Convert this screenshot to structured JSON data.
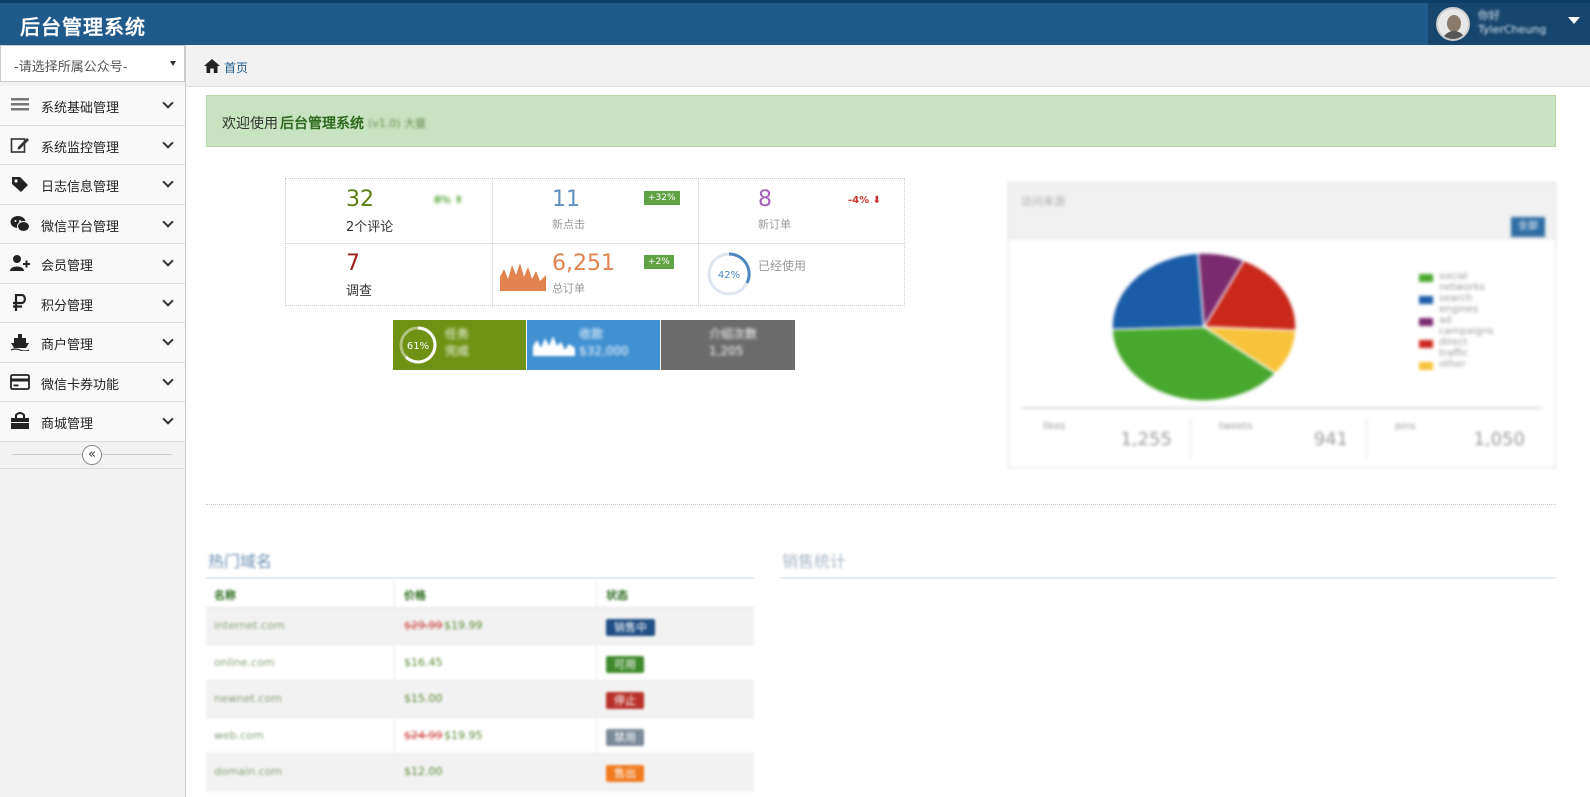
{
  "app": {
    "title": "后台管理系统"
  },
  "user": {
    "line1": "你好",
    "line2": "TylerCheung"
  },
  "account_select": {
    "value": "-请选择所属公众号-"
  },
  "sidebar": {
    "items": [
      {
        "label": "系统基础管理",
        "icon": "list-icon"
      },
      {
        "label": "系统监控管理",
        "icon": "edit-icon"
      },
      {
        "label": "日志信息管理",
        "icon": "tag-icon"
      },
      {
        "label": "微信平台管理",
        "icon": "wechat-icon"
      },
      {
        "label": "会员管理",
        "icon": "add-user-icon"
      },
      {
        "label": "积分管理",
        "icon": "ruble-icon"
      },
      {
        "label": "商户管理",
        "icon": "ship-icon"
      },
      {
        "label": "微信卡券功能",
        "icon": "credit-card-icon"
      },
      {
        "label": "商城管理",
        "icon": "shopping-bag-icon"
      }
    ],
    "collapse_label": "«"
  },
  "breadcrumb": {
    "home": "首页"
  },
  "welcome": {
    "prefix": "欢迎使用",
    "name": "后台管理系统",
    "version": "(v1.0) 大量"
  },
  "stats": [
    {
      "value": "32",
      "label": "2个评论",
      "trend": "8%",
      "color": "#6a8a1f"
    },
    {
      "value": "11",
      "label": "新点击",
      "trend": "+32%",
      "color": "#5f8fc0"
    },
    {
      "value": "8",
      "label": "新订单",
      "trend": "-4%",
      "color": "#a55fb8"
    },
    {
      "value": "7",
      "label": "调查",
      "trend": "",
      "color": "#a33"
    },
    {
      "value": "6,251",
      "label": "总订单",
      "trend": "+2%",
      "color": "#e2824f"
    },
    {
      "value": "",
      "label": "已经使用",
      "trend": "",
      "color": "#5f8fc0",
      "percent": "42%"
    }
  ],
  "tiles": [
    {
      "title": "任务",
      "sub": "完成",
      "percent": "61%",
      "color": "#6f9214"
    },
    {
      "title": "收款",
      "sub": "$32,000",
      "color": "#4090d2"
    },
    {
      "title": "介绍次数",
      "sub": "1,205",
      "color": "#6b6b6b"
    }
  ],
  "traffic": {
    "title": "访问来源",
    "button": "全部",
    "chart_data": {
      "type": "pie",
      "series": [
        {
          "name": "social networks",
          "value": 38.7,
          "color": "#48a82d"
        },
        {
          "name": "search engines",
          "value": 24.5,
          "color": "#1a5ca8"
        },
        {
          "name": "ad campaigns",
          "value": 8.2,
          "color": "#7a2a6e"
        },
        {
          "name": "direct traffic",
          "value": 18.6,
          "color": "#c9281a"
        },
        {
          "name": "other",
          "value": 10.0,
          "color": "#f7c33a"
        }
      ]
    },
    "footer": [
      {
        "label": "likes",
        "value": "1,255"
      },
      {
        "label": "tweets",
        "value": "941"
      },
      {
        "label": "pins",
        "value": "1,050"
      }
    ]
  },
  "hot_domains": {
    "title": "热门域名",
    "columns": [
      "名称",
      "价格",
      "状态"
    ],
    "rows": [
      {
        "name": "internet.com",
        "price_old": "$29.99",
        "price": "$19.99",
        "status": "销售中",
        "status_color": "#1f4f85"
      },
      {
        "name": "online.com",
        "price_old": "",
        "price": "$16.45",
        "status": "可用",
        "status_color": "#3f8a2d"
      },
      {
        "name": "newnet.com",
        "price_old": "",
        "price": "$15.00",
        "status": "停止",
        "status_color": "#b8322a"
      },
      {
        "name": "web.com",
        "price_old": "$24.99",
        "price": "$19.95",
        "status": "禁用",
        "status_color": "#7b8a98"
      },
      {
        "name": "domain.com",
        "price_old": "",
        "price": "$12.00",
        "status": "售出",
        "status_color": "#f07a1f"
      }
    ]
  },
  "sales": {
    "title": "销售统计"
  }
}
